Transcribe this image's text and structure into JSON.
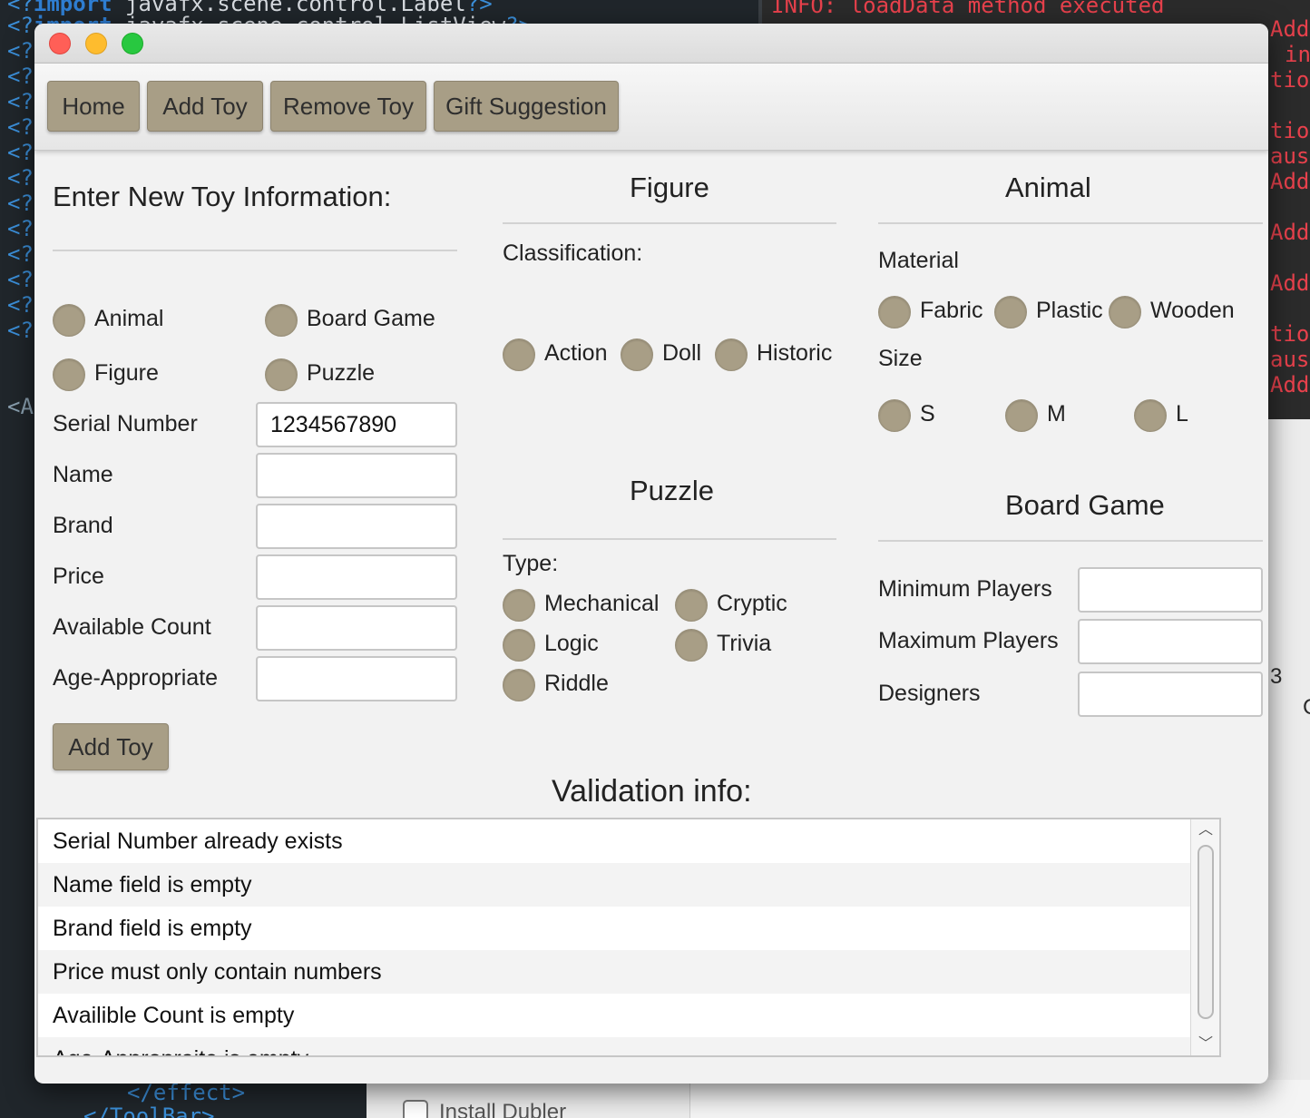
{
  "background": {
    "editor_lines": [
      {
        "prefix": "<?",
        "keyword": "import",
        "text": " javafx.scene.control.Label",
        "suffix": "?>"
      },
      {
        "prefix": "<?",
        "keyword": "import",
        "text": " javafx.scene.control.ListView",
        "suffix": "?>"
      },
      {
        "prefix": "<?",
        "keyword": "",
        "text": "",
        "suffix": ""
      },
      {
        "prefix": "<?",
        "keyword": "",
        "text": "",
        "suffix": ""
      },
      {
        "prefix": "<?",
        "keyword": "",
        "text": "",
        "suffix": ""
      },
      {
        "prefix": "<?",
        "keyword": "",
        "text": "",
        "suffix": ""
      },
      {
        "prefix": "<?",
        "keyword": "",
        "text": "",
        "suffix": ""
      },
      {
        "prefix": "<?",
        "keyword": "",
        "text": "",
        "suffix": ""
      },
      {
        "prefix": "<?",
        "keyword": "",
        "text": "",
        "suffix": ""
      },
      {
        "prefix": "<?",
        "keyword": "",
        "text": "",
        "suffix": ""
      },
      {
        "prefix": "<?",
        "keyword": "",
        "text": "",
        "suffix": ""
      },
      {
        "prefix": "<?",
        "keyword": "",
        "text": "",
        "suffix": ""
      },
      {
        "prefix": "<?",
        "keyword": "",
        "text": "",
        "suffix": ""
      },
      {
        "prefix": "<?",
        "keyword": "",
        "text": "",
        "suffix": ""
      }
    ],
    "editor_tag_a": "<A",
    "editor_bottom_1": "</effect>",
    "editor_bottom_2": "</ToolBar>",
    "console_top": "INFO: loadData method executed",
    "console_right": [
      "Add",
      "in",
      "tion",
      "",
      "tion",
      "ause",
      "Add",
      "",
      "Add",
      "",
      "Add",
      "",
      "tion",
      "ause",
      "Add"
    ],
    "side_number": "3",
    "side_letter": "C",
    "install_label": "Install Dubler"
  },
  "toolbar": {
    "home": "Home",
    "add_toy": "Add Toy",
    "remove_toy": "Remove Toy",
    "gift_suggestion": "Gift Suggestion"
  },
  "form": {
    "title": "Enter New Toy Information:",
    "types": {
      "animal": "Animal",
      "board_game": "Board Game",
      "figure": "Figure",
      "puzzle": "Puzzle"
    },
    "fields": {
      "serial_number": {
        "label": "Serial Number",
        "value": "1234567890"
      },
      "name": {
        "label": "Name",
        "value": ""
      },
      "brand": {
        "label": "Brand",
        "value": ""
      },
      "price": {
        "label": "Price",
        "value": ""
      },
      "available_count": {
        "label": "Available Count",
        "value": ""
      },
      "age_appropriate": {
        "label": "Age-Appropriate",
        "value": ""
      }
    },
    "add_button": "Add Toy"
  },
  "figure": {
    "title": "Figure",
    "classification_label": "Classification:",
    "options": {
      "action": "Action",
      "doll": "Doll",
      "historic": "Historic"
    }
  },
  "animal": {
    "title": "Animal",
    "material_label": "Material",
    "materials": {
      "fabric": "Fabric",
      "plastic": "Plastic",
      "wooden": "Wooden"
    },
    "size_label": "Size",
    "sizes": {
      "s": "S",
      "m": "M",
      "l": "L"
    }
  },
  "puzzle": {
    "title": "Puzzle",
    "type_label": "Type:",
    "options": {
      "mechanical": "Mechanical",
      "cryptic": "Cryptic",
      "logic": "Logic",
      "trivia": "Trivia",
      "riddle": "Riddle"
    }
  },
  "board_game": {
    "title": "Board Game",
    "min_players": {
      "label": "Minimum Players",
      "value": ""
    },
    "max_players": {
      "label": "Maximum Players",
      "value": ""
    },
    "designers": {
      "label": "Designers",
      "value": ""
    }
  },
  "validation": {
    "title": "Validation info:",
    "messages": [
      "Serial Number already exists",
      "Name field is empty",
      "Brand field is empty",
      "Price must only contain numbers",
      "Availible Count is empty",
      "Age-Appropraite is empty"
    ]
  }
}
